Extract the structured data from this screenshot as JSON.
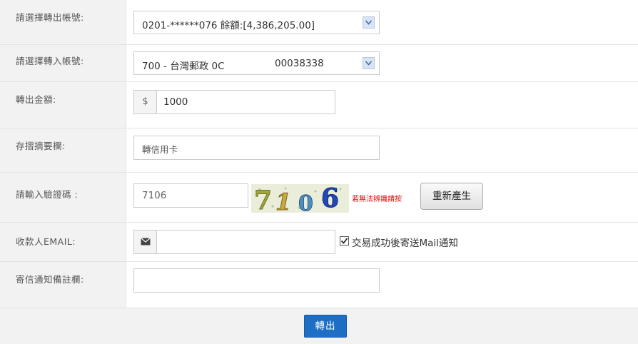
{
  "rows": {
    "from_account": {
      "label": "請選擇轉出帳號:",
      "value": "0201-******076 餘額:[4,386,205.00]"
    },
    "to_account": {
      "label": "請選擇轉入帳號:",
      "value_bank": "700 - 台灣郵政 0C",
      "value_number": "00038338"
    },
    "amount": {
      "label": "轉出金額:",
      "currency_symbol": "$",
      "value": "1000"
    },
    "memo": {
      "label": "存摺摘要欄:",
      "value": "轉信用卡"
    },
    "captcha": {
      "label": "請輸入驗證碼 :",
      "value": "7106",
      "image_text": [
        "7",
        "1",
        "0",
        "6"
      ],
      "hint": "若無法辨識請按",
      "regenerate_label": "重新產生"
    },
    "email": {
      "label": "收款人EMAIL:",
      "value": "",
      "notify_checked": true,
      "notify_label": "交易成功後寄送Mail通知"
    },
    "email_note": {
      "label": "寄信通知備註欄:",
      "value": ""
    }
  },
  "submit_label": "轉出",
  "icons": {
    "dropdown": "chevron-down-icon",
    "email": "envelope-icon",
    "checkbox": "checkmark-icon"
  },
  "colors": {
    "submit_bg": "#1c6fc5",
    "hint_text": "#dd0000",
    "label_bg": "#f2f2f2"
  }
}
